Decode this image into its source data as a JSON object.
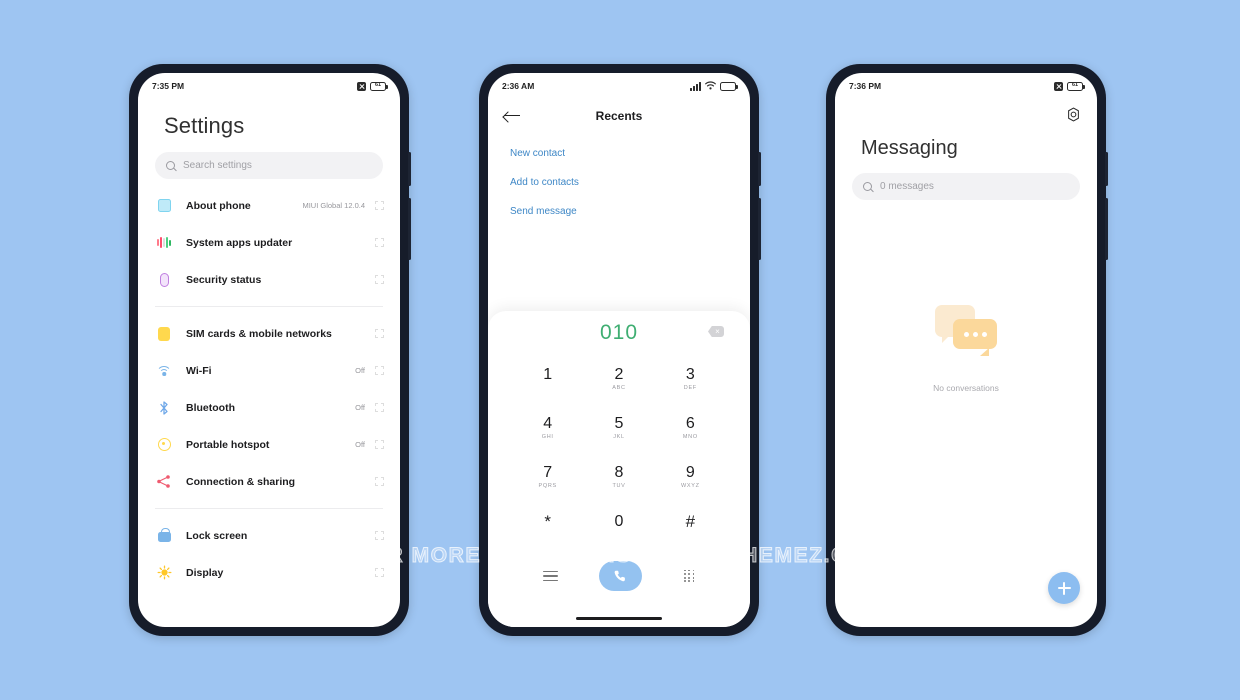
{
  "background_color": "#9ec5f2",
  "watermark": "FOR MORE THEMES VISIT - MIUITHEMEZ.COM",
  "phone_settings": {
    "status": {
      "time": "7:35 PM",
      "battery": "61"
    },
    "title": "Settings",
    "search": {
      "placeholder": "Search settings"
    },
    "groups": [
      {
        "items": [
          {
            "label": "About phone",
            "value": "MIUI Global 12.0.4",
            "icon": "square-icon"
          },
          {
            "label": "System apps updater",
            "value": "",
            "icon": "bars-icon"
          },
          {
            "label": "Security status",
            "value": "",
            "icon": "shield-icon"
          }
        ]
      },
      {
        "items": [
          {
            "label": "SIM cards & mobile networks",
            "value": "",
            "icon": "sim-icon"
          },
          {
            "label": "Wi-Fi",
            "value": "Off",
            "icon": "wifi-icon"
          },
          {
            "label": "Bluetooth",
            "value": "Off",
            "icon": "bluetooth-icon"
          },
          {
            "label": "Portable hotspot",
            "value": "Off",
            "icon": "hotspot-icon"
          },
          {
            "label": "Connection & sharing",
            "value": "",
            "icon": "share-icon"
          }
        ]
      },
      {
        "items": [
          {
            "label": "Lock screen",
            "value": "",
            "icon": "lock-icon"
          },
          {
            "label": "Display",
            "value": "",
            "icon": "sun-icon"
          }
        ]
      }
    ]
  },
  "phone_dialer": {
    "status": {
      "time": "2:36 AM"
    },
    "title": "Recents",
    "links": [
      "New contact",
      "Add to contacts",
      "Send message"
    ],
    "number": "010",
    "number_color": "#3fae72",
    "keys": [
      {
        "digit": "1",
        "letters": ""
      },
      {
        "digit": "2",
        "letters": "ABC"
      },
      {
        "digit": "3",
        "letters": "DEF"
      },
      {
        "digit": "4",
        "letters": "GHI"
      },
      {
        "digit": "5",
        "letters": "JKL"
      },
      {
        "digit": "6",
        "letters": "MNO"
      },
      {
        "digit": "7",
        "letters": "PQRS"
      },
      {
        "digit": "8",
        "letters": "TUV"
      },
      {
        "digit": "9",
        "letters": "WXYZ"
      },
      {
        "digit": "*",
        "letters": ""
      },
      {
        "digit": "0",
        "letters": "+"
      },
      {
        "digit": "#",
        "letters": ""
      }
    ],
    "call_button_color": "#94c2f0"
  },
  "phone_messaging": {
    "status": {
      "time": "7:36 PM",
      "battery": "61"
    },
    "title": "Messaging",
    "search": {
      "placeholder": "0 messages"
    },
    "empty_state": "No conversations",
    "fab_color": "#8cbdf0"
  }
}
